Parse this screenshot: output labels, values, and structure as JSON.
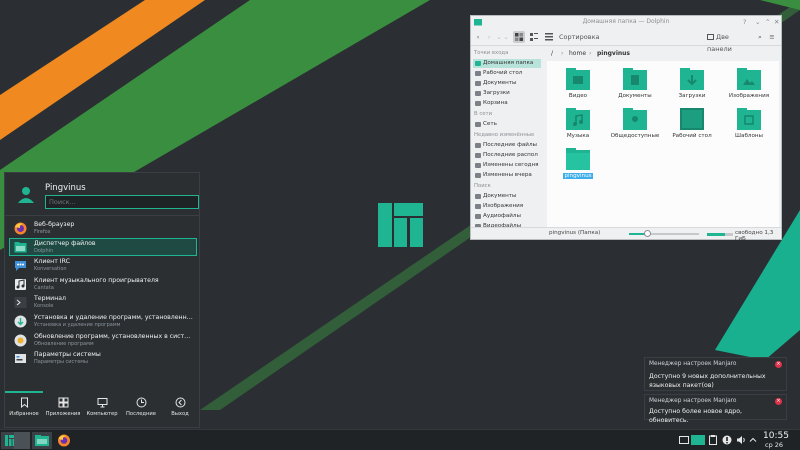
{
  "colors": {
    "accent": "#1fb593",
    "wallpaper_base": "#2b2f33",
    "stripe_green": "#3a8e3f",
    "stripe_orange": "#f08a20",
    "stripe_teal": "#19b08f"
  },
  "launcher": {
    "username": "Pingvinus",
    "search_placeholder": "Поиск...",
    "apps": [
      {
        "title": "Веб-браузер",
        "subtitle": "Firefox",
        "icon": "firefox-icon"
      },
      {
        "title": "Диспетчер файлов",
        "subtitle": "Dolphin",
        "icon": "folder-icon"
      },
      {
        "title": "Клиент IRC",
        "subtitle": "Konversation",
        "icon": "chat-icon"
      },
      {
        "title": "Клиент музыкального проигрывателя",
        "subtitle": "Cantata",
        "icon": "music-icon"
      },
      {
        "title": "Терминал",
        "subtitle": "Konsole",
        "icon": "terminal-icon"
      },
      {
        "title": "Установка и удаление программ, установленных в с...",
        "subtitle": "Установка и удаление программ",
        "icon": "package-icon"
      },
      {
        "title": "Обновление программ, установленных в системе",
        "subtitle": "Обновление программ",
        "icon": "update-icon"
      },
      {
        "title": "Параметры системы",
        "subtitle": "Параметры системы",
        "icon": "settings-icon"
      }
    ],
    "tabs": [
      {
        "label": "Избранное",
        "icon": "bookmark-icon"
      },
      {
        "label": "Приложения",
        "icon": "grid-icon"
      },
      {
        "label": "Компьютер",
        "icon": "monitor-icon"
      },
      {
        "label": "Последние",
        "icon": "clock-icon"
      },
      {
        "label": "Выход",
        "icon": "exit-icon"
      }
    ]
  },
  "dolphin": {
    "title": "Домашняя папка — Dolphin",
    "sort_label": "Сортировка",
    "split_label": "Две панели",
    "breadcrumb": {
      "root": "/",
      "home": "home",
      "current": "pingvinus"
    },
    "sidebar": {
      "places_header": "Точки входа",
      "places": [
        "Домашняя папка",
        "Рабочий стол",
        "Документы",
        "Загрузки",
        "Корзина"
      ],
      "network_header": "В сети",
      "network": [
        "Сеть"
      ],
      "recent_header": "Недавно изменённые",
      "recent": [
        "Последние файлы",
        "Последние распол",
        "Изменены сегодня",
        "Изменены вчера"
      ],
      "search_header": "Поиск",
      "search": [
        "Документы",
        "Изображения",
        "Аудиофайлы",
        "Видеофайлы"
      ]
    },
    "files": [
      {
        "name": "Видео",
        "icon": "video-folder-icon"
      },
      {
        "name": "Документы",
        "icon": "documents-folder-icon"
      },
      {
        "name": "Загрузки",
        "icon": "downloads-folder-icon"
      },
      {
        "name": "Изображения",
        "icon": "pictures-folder-icon"
      },
      {
        "name": "Музыка",
        "icon": "music-folder-icon"
      },
      {
        "name": "Общедоступные",
        "icon": "public-folder-icon"
      },
      {
        "name": "Рабочий стол",
        "icon": "desktop-folder-icon"
      },
      {
        "name": "Шаблоны",
        "icon": "templates-folder-icon"
      },
      {
        "name": "pingvinus",
        "icon": "folder-icon"
      }
    ],
    "status": "pingvinus (Папка)",
    "free_space": "свободно 1,3 ГиБ",
    "zoom_level": 0.25,
    "disk_used": 0.7
  },
  "notifications": [
    {
      "title": "Менеджер настроек Manjaro",
      "body": "Доступно 9 новых дополнительных языковых пакет(ов)"
    },
    {
      "title": "Менеджер настроек Manjaro",
      "body": "Доступно более новое ядро, обновитесь."
    }
  ],
  "taskbar": {
    "time": "10:55",
    "date": "ср 26"
  }
}
